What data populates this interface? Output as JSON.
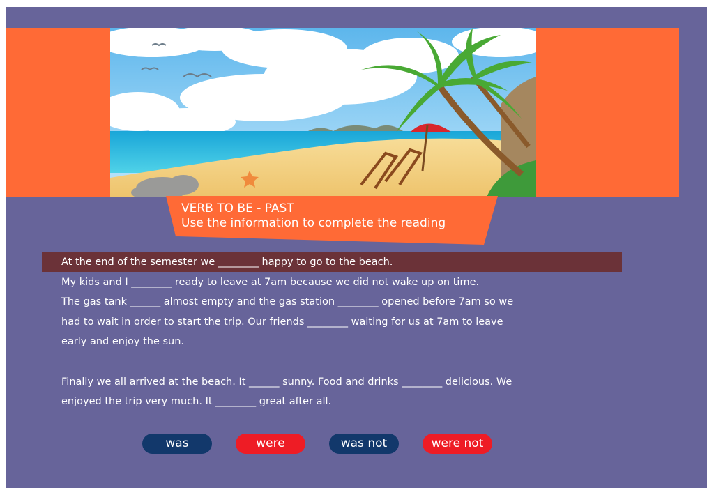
{
  "header": {
    "title": "VERB TO BE - PAST",
    "subtitle": "Use the information to complete the reading"
  },
  "reading": {
    "lines": [
      "At the end of the semester we  ________  happy to go to the beach.",
      "My kids and I ________ ready to leave at 7am because we did not wake up on time.",
      "The gas tank ______ almost empty and the gas station ________ opened before 7am so we",
      "had to wait in order to start the trip. Our friends ________ waiting for us at 7am to leave",
      "early and enjoy the sun.",
      "Finally we all arrived at the beach. It ______ sunny. Food and drinks ________ delicious. We",
      "enjoyed the trip very much. It ________ great after all."
    ]
  },
  "options": [
    {
      "label": "was",
      "color": "#12386b"
    },
    {
      "label": "were",
      "color": "#ee1c25"
    },
    {
      "label": "was not",
      "color": "#12386b"
    },
    {
      "label": "were not",
      "color": "#ee1c25"
    }
  ],
  "colors": {
    "background": "#67649a",
    "accent_orange": "#ff6a36",
    "highlight": "#6b3238"
  },
  "banner": {
    "image": "beach-scene-illustration"
  }
}
